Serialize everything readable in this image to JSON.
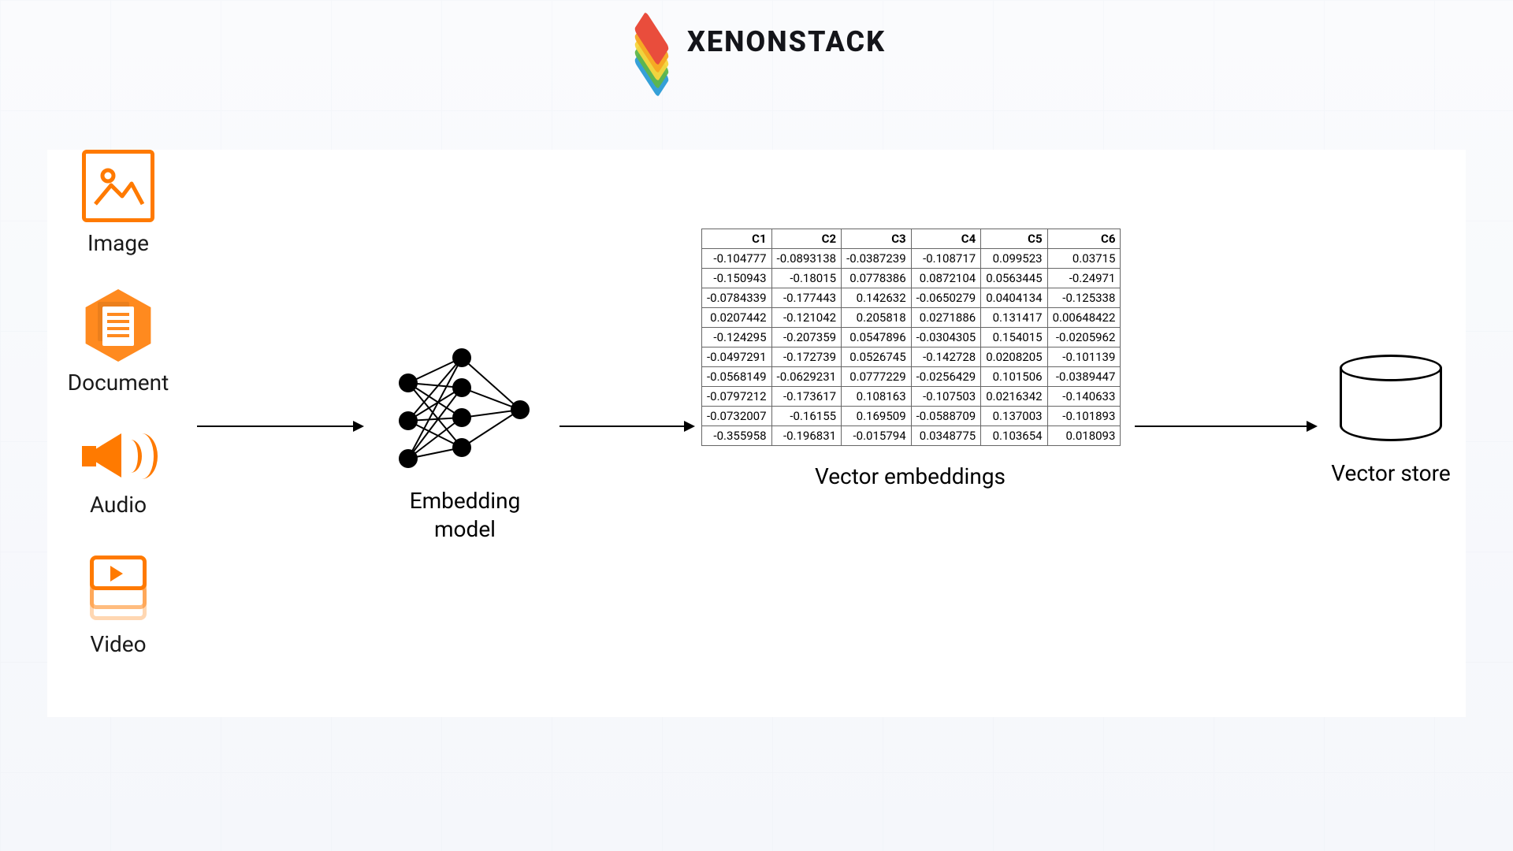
{
  "brand": "XENONSTACK",
  "inputs": {
    "image": "Image",
    "document": "Document",
    "audio": "Audio",
    "video": "Video"
  },
  "model_label": "Embedding model",
  "table": {
    "headers": [
      "C1",
      "C2",
      "C3",
      "C4",
      "C5",
      "C6"
    ],
    "rows": [
      [
        "-0.104777",
        "-0.0893138",
        "-0.0387239",
        "-0.108717",
        "0.099523",
        "0.03715"
      ],
      [
        "-0.150943",
        "-0.18015",
        "0.0778386",
        "0.0872104",
        "0.0563445",
        "-0.24971"
      ],
      [
        "-0.0784339",
        "-0.177443",
        "0.142632",
        "-0.0650279",
        "0.0404134",
        "-0.125338"
      ],
      [
        "0.0207442",
        "-0.121042",
        "0.205818",
        "0.0271886",
        "0.131417",
        "0.00648422"
      ],
      [
        "-0.124295",
        "-0.207359",
        "0.0547896",
        "-0.0304305",
        "0.154015",
        "-0.0205962"
      ],
      [
        "-0.0497291",
        "-0.172739",
        "0.0526745",
        "-0.142728",
        "0.0208205",
        "-0.101139"
      ],
      [
        "-0.0568149",
        "-0.0629231",
        "0.0777229",
        "-0.0256429",
        "0.101506",
        "-0.0389447"
      ],
      [
        "-0.0797212",
        "-0.173617",
        "0.108163",
        "-0.107503",
        "0.0216342",
        "-0.140633"
      ],
      [
        "-0.0732007",
        "-0.16155",
        "0.169509",
        "-0.0588709",
        "0.137003",
        "-0.101893"
      ],
      [
        "-0.355958",
        "-0.196831",
        "-0.015794",
        "0.0348775",
        "0.103654",
        "0.018093"
      ]
    ],
    "caption": "Vector embeddings"
  },
  "store_label": "Vector store"
}
